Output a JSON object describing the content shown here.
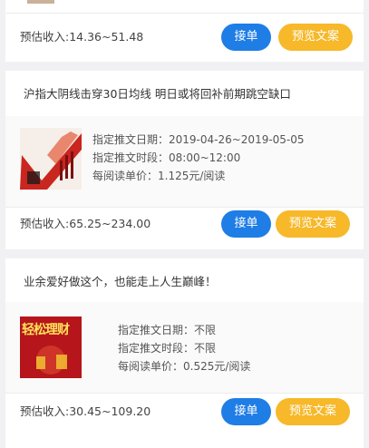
{
  "cards": [
    {
      "footer": {
        "income": "预估收入:14.36~51.48",
        "take_label": "接单",
        "preview_label": "预览文案"
      }
    },
    {
      "title": "沪指大阴线击穿30日均线 明日或将回补前期跳空缺口",
      "details": [
        "指定推文日期：2019-04-26~2019-05-05",
        "指定推文时段：08:00~12:00",
        "每阅读单价：1.125元/阅读"
      ],
      "footer": {
        "income": "预估收入:65.25~234.00",
        "take_label": "接单",
        "preview_label": "预览文案"
      }
    },
    {
      "title": "业余爱好做这个，也能走上人生巅峰！",
      "thumb_text": "轻松理财",
      "details": [
        "指定推文日期：不限",
        "指定推文时段：不限",
        "每阅读单价：0.525元/阅读"
      ],
      "footer": {
        "income": "预估收入:30.45~109.20",
        "take_label": "接单",
        "preview_label": "预览文案"
      }
    }
  ],
  "colors": {
    "take_button": "#1f7de6",
    "preview_button": "#f7b829",
    "page_background": "#f1f1f3"
  }
}
